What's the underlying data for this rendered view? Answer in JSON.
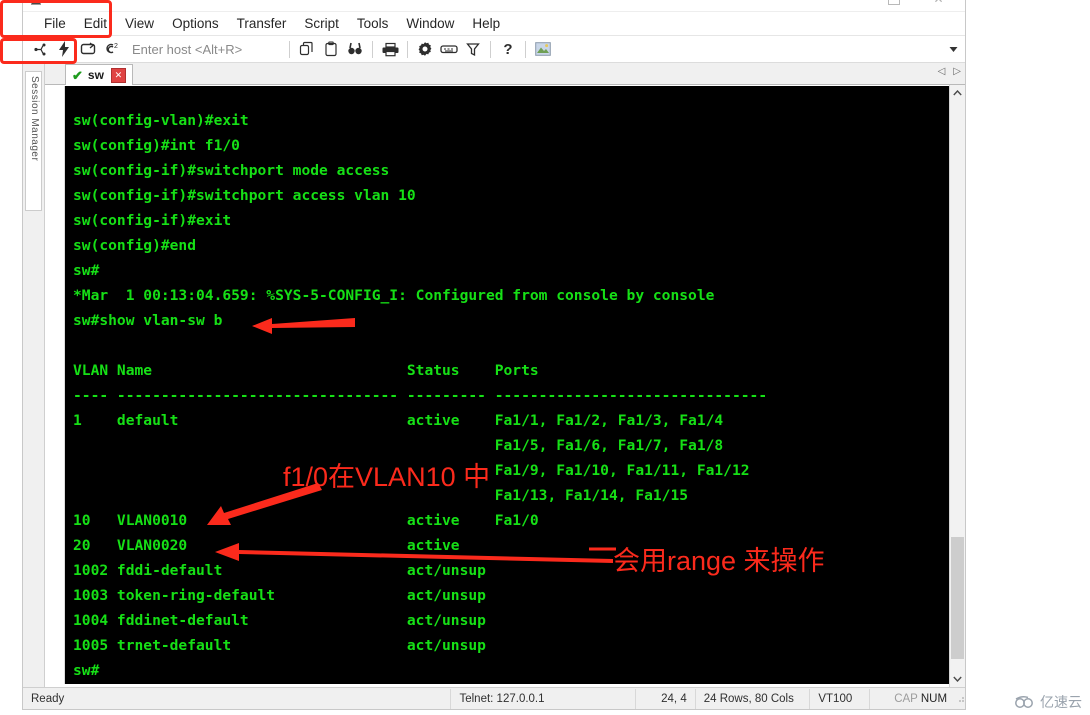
{
  "window": {
    "title": "sw",
    "icon_name": "app-icon",
    "buttons": [
      {
        "name": "minimize",
        "glyph": "—"
      },
      {
        "name": "maximize",
        "glyph": "□"
      },
      {
        "name": "close",
        "glyph": "✕"
      }
    ]
  },
  "menubar": {
    "items": [
      {
        "label": "File"
      },
      {
        "label": "Edit"
      },
      {
        "label": "View"
      },
      {
        "label": "Options"
      },
      {
        "label": "Transfer"
      },
      {
        "label": "Script"
      },
      {
        "label": "Tools"
      },
      {
        "label": "Window"
      },
      {
        "label": "Help"
      }
    ]
  },
  "toolbar": {
    "host_placeholder": "Enter host <Alt+R>",
    "host_value": "",
    "icons": [
      {
        "name": "connect-icon",
        "glyph": "⑂"
      },
      {
        "name": "quick-connect-icon",
        "glyph": "⚡"
      },
      {
        "name": "reconnect-icon",
        "glyph": "↻"
      },
      {
        "name": "disconnect-icon",
        "glyph": "⌁"
      },
      {
        "name": "copy-icon",
        "glyph": "❐"
      },
      {
        "name": "paste-icon",
        "glyph": "⌸"
      },
      {
        "name": "find-icon",
        "glyph": "⚲"
      },
      {
        "name": "print-icon",
        "glyph": "⎙"
      },
      {
        "name": "settings-icon",
        "glyph": "⚙"
      },
      {
        "name": "keymap-icon",
        "glyph": "⌨"
      },
      {
        "name": "filter-icon",
        "glyph": "⚗"
      },
      {
        "name": "help-icon",
        "glyph": "?"
      },
      {
        "name": "image-icon",
        "glyph": "Ὓc"
      }
    ],
    "dropdown_glyph": "▼"
  },
  "sidebar": {
    "label": "Session Manager"
  },
  "tabs": {
    "active": {
      "label": "sw",
      "status_glyph": "✔",
      "close_glyph": "✕"
    },
    "scroll_left_glyph": "◁",
    "scroll_right_glyph": "▷"
  },
  "terminal": {
    "foreground": "#16e016",
    "background": "#000000",
    "lines": [
      "sw(config-vlan)#exit",
      "sw(config)#int f1/0",
      "sw(config-if)#switchport mode access",
      "sw(config-if)#switchport access vlan 10",
      "sw(config-if)#exit",
      "sw(config)#end",
      "sw#",
      "*Mar  1 00:13:04.659: %SYS-5-CONFIG_I: Configured from console by console",
      "sw#show vlan-sw b",
      "",
      "VLAN Name                             Status    Ports",
      "---- -------------------------------- --------- -------------------------------",
      "1    default                          active    Fa1/1, Fa1/2, Fa1/3, Fa1/4",
      "                                                Fa1/5, Fa1/6, Fa1/7, Fa1/8",
      "                                                Fa1/9, Fa1/10, Fa1/11, Fa1/12",
      "                                                Fa1/13, Fa1/14, Fa1/15",
      "10   VLAN0010                         active    Fa1/0",
      "20   VLAN0020                         active",
      "1002 fddi-default                     act/unsup",
      "1003 token-ring-default               act/unsup",
      "1004 fddinet-default                  act/unsup",
      "1005 trnet-default                    act/unsup",
      "sw#"
    ]
  },
  "vlan_table": {
    "headers": [
      "VLAN",
      "Name",
      "Status",
      "Ports"
    ],
    "rows": [
      {
        "vlan": "1",
        "name": "default",
        "status": "active",
        "ports": "Fa1/1, Fa1/2, Fa1/3, Fa1/4, Fa1/5, Fa1/6, Fa1/7, Fa1/8, Fa1/9, Fa1/10, Fa1/11, Fa1/12, Fa1/13, Fa1/14, Fa1/15"
      },
      {
        "vlan": "10",
        "name": "VLAN0010",
        "status": "active",
        "ports": "Fa1/0"
      },
      {
        "vlan": "20",
        "name": "VLAN0020",
        "status": "active",
        "ports": ""
      },
      {
        "vlan": "1002",
        "name": "fddi-default",
        "status": "act/unsup",
        "ports": ""
      },
      {
        "vlan": "1003",
        "name": "token-ring-default",
        "status": "act/unsup",
        "ports": ""
      },
      {
        "vlan": "1004",
        "name": "fddinet-default",
        "status": "act/unsup",
        "ports": ""
      },
      {
        "vlan": "1005",
        "name": "trnet-default",
        "status": "act/unsup",
        "ports": ""
      }
    ]
  },
  "annotations": {
    "color": "#fb2a1c",
    "note_vlan10": "f1/0在VLAN10 中",
    "note_range": "会用range 来操作"
  },
  "statusbar": {
    "ready": "Ready",
    "connection": "Telnet: 127.0.0.1",
    "cursor": "24,  4",
    "size": "24 Rows, 80 Cols",
    "emulation": "VT100",
    "cap": "CAP",
    "num": "NUM"
  },
  "watermark": {
    "text": "亿速云"
  }
}
